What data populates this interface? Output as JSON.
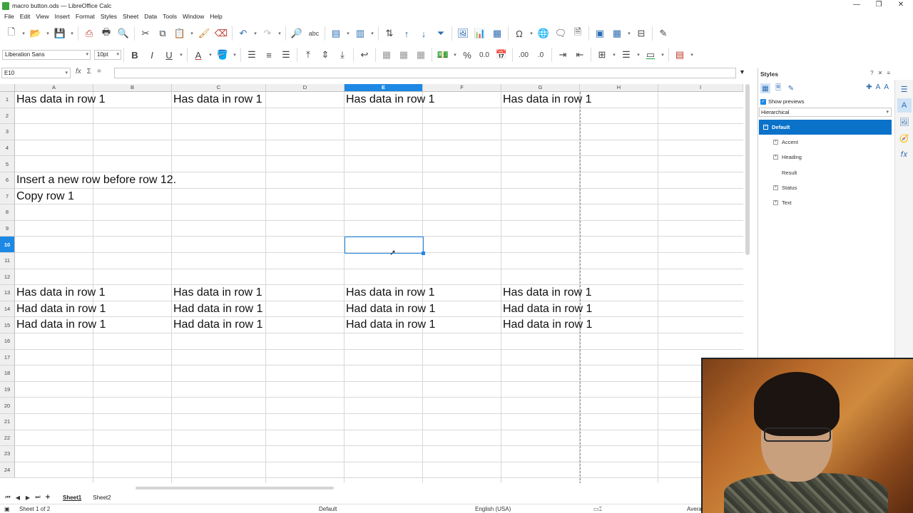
{
  "window": {
    "title": "macro button.ods — LibreOffice Calc",
    "controls": [
      "—",
      "❐",
      "✕"
    ]
  },
  "menu": [
    "File",
    "Edit",
    "View",
    "Insert",
    "Format",
    "Styles",
    "Sheet",
    "Data",
    "Tools",
    "Window",
    "Help"
  ],
  "formatting": {
    "font_name": "Liberation Sans",
    "font_size": "10pt"
  },
  "formula_bar": {
    "name_box": "E10",
    "fx_label": "fx",
    "sum_label": "Σ",
    "equals_label": "=",
    "value": ""
  },
  "columns": [
    "A",
    "B",
    "C",
    "D",
    "E",
    "F",
    "G",
    "H",
    "I"
  ],
  "selected_column": "E",
  "rows": [
    "1",
    "2",
    "3",
    "4",
    "5",
    "6",
    "7",
    "8",
    "9",
    "10",
    "11",
    "12",
    "13",
    "14",
    "15",
    "16",
    "17",
    "18",
    "19",
    "20",
    "21",
    "22",
    "23",
    "24"
  ],
  "selected_row": "10",
  "cells": {
    "A1": "Has data in row 1",
    "C1": "Has data in row 1",
    "E1": "Has data in row 1",
    "G1": "Has data in row 1",
    "A6": "Insert a new row before row 12.",
    "A7": "Copy row 1",
    "A13": "Has data in row 1",
    "C13": "Has data in row 1",
    "E13": "Has data in row 1",
    "G13": "Has data in row 1",
    "A14": "Had data in row 1",
    "C14": "Had data in row 1",
    "E14": "Had data in row 1",
    "G14": "Had data in row 1",
    "A15": "Had data in row 1",
    "C15": "Had data in row 1",
    "E15": "Had data in row 1",
    "G15": "Had data in row 1"
  },
  "sheets": {
    "tabs": [
      "Sheet1",
      "Sheet2"
    ],
    "active": "Sheet1"
  },
  "status": {
    "sheet_position": "Sheet 1 of 2",
    "page_style": "Default",
    "language": "English (USA)",
    "aggregate": "Avera"
  },
  "sidebar": {
    "title": "Styles",
    "show_previews": "Show previews",
    "filter": "Hierarchical",
    "styles": [
      {
        "name": "Default",
        "expander": "−",
        "selected": true
      },
      {
        "name": "Accent",
        "expander": "+"
      },
      {
        "name": "Heading",
        "expander": "+"
      },
      {
        "name": "Result",
        "expander": ""
      },
      {
        "name": "Status",
        "expander": "+"
      },
      {
        "name": "Text",
        "expander": "+"
      }
    ]
  },
  "colors": {
    "accent": "#1e88e5",
    "sidebar_selected": "#0a72c9",
    "app_icon": "#3da33d"
  }
}
